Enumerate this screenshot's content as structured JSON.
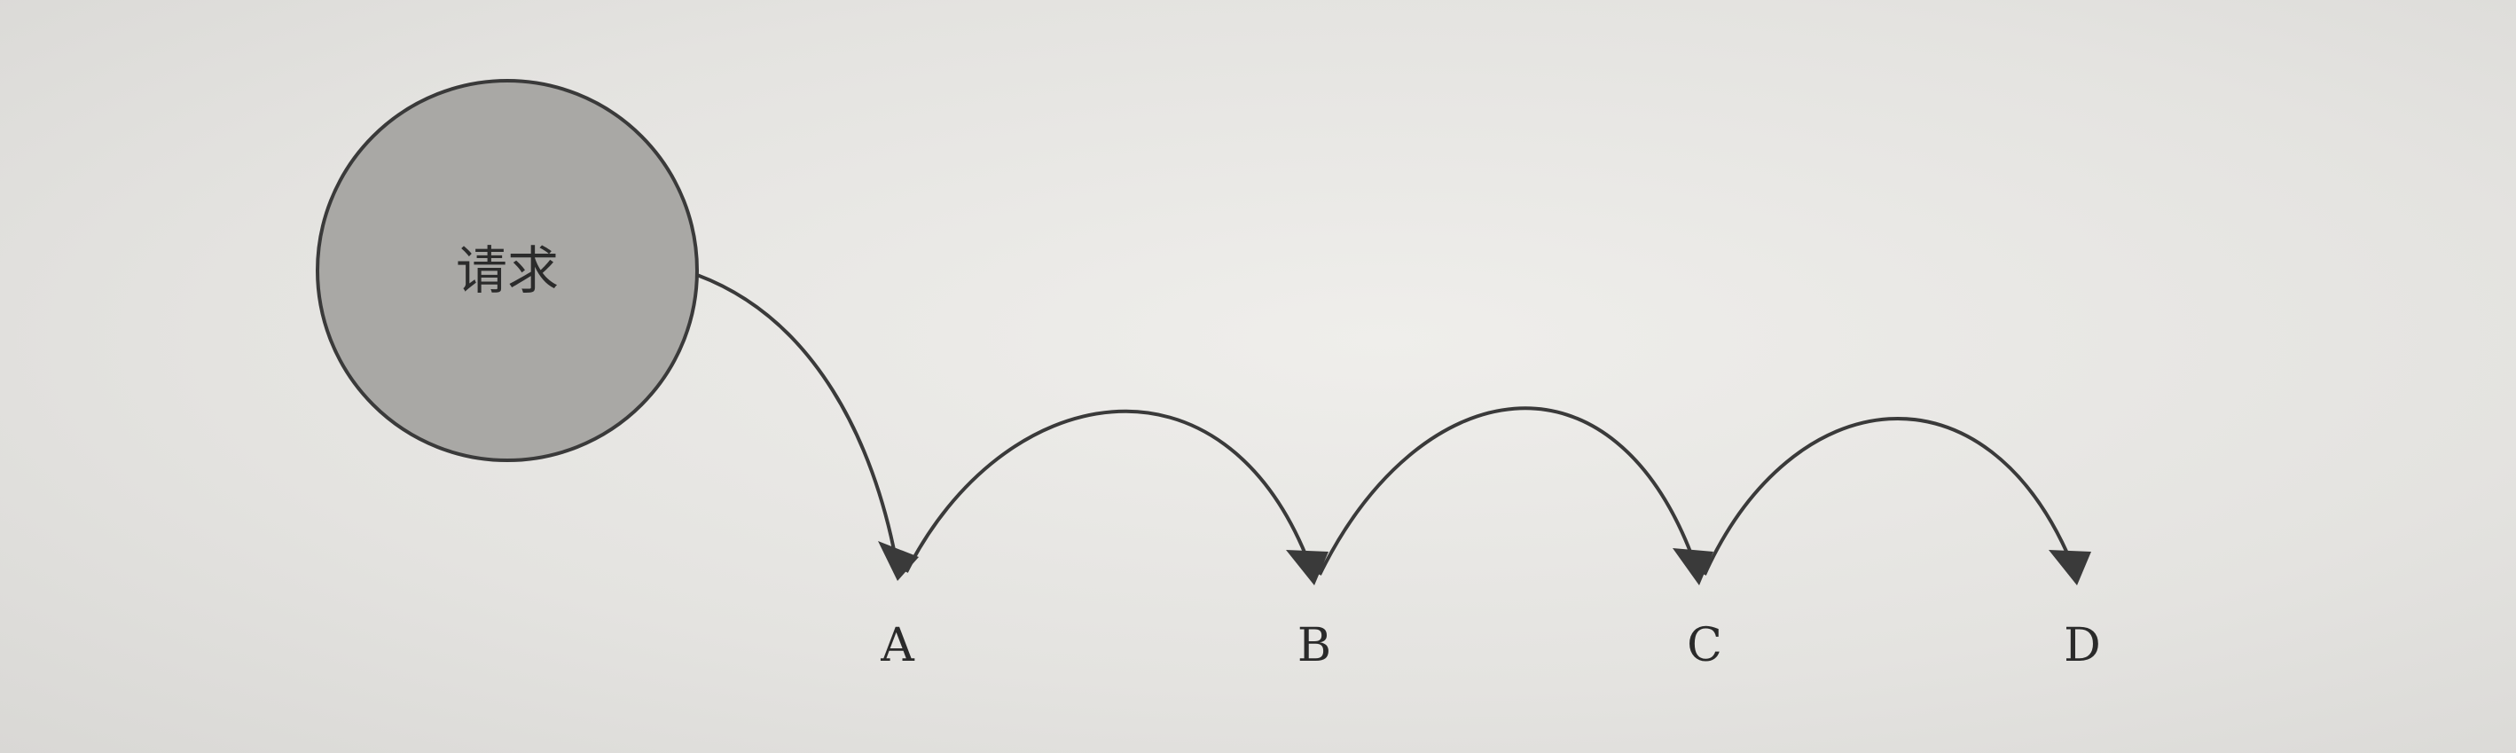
{
  "diagram": {
    "request_node": {
      "label": "请求"
    },
    "nodes": [
      {
        "id": "A",
        "label": "A"
      },
      {
        "id": "B",
        "label": "B"
      },
      {
        "id": "C",
        "label": "C"
      },
      {
        "id": "D",
        "label": "D"
      }
    ],
    "edges": [
      {
        "from": "请求",
        "to": "A"
      },
      {
        "from": "A",
        "to": "B"
      },
      {
        "from": "B",
        "to": "C"
      },
      {
        "from": "C",
        "to": "D"
      }
    ],
    "colors": {
      "request_fill": "#a9a8a5",
      "stroke": "#3a3a3a"
    }
  }
}
